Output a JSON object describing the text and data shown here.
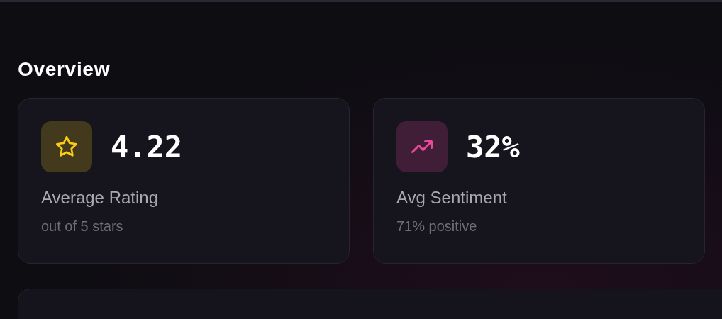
{
  "section_title": "Overview",
  "stats": [
    {
      "kind": "star",
      "color": "#facc15",
      "value": "4.22",
      "label": "Average Rating",
      "note": "out of 5 stars"
    },
    {
      "kind": "trend",
      "color": "#ec4899",
      "value": "32%",
      "label": "Avg Sentiment",
      "note": "71% positive"
    }
  ]
}
